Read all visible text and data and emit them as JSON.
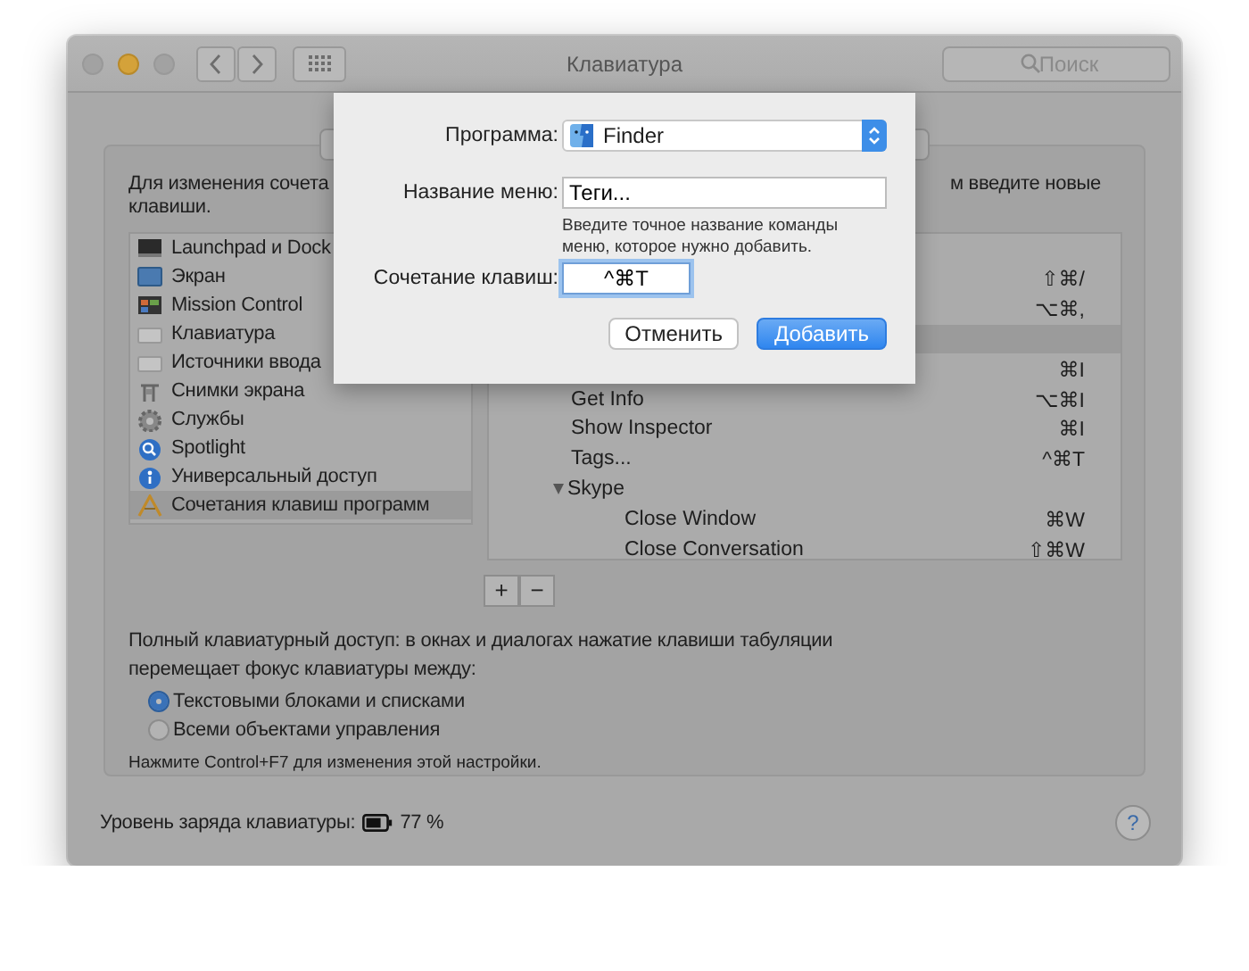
{
  "window": {
    "title": "Клавиатура",
    "search": {
      "placeholder": "Поиск"
    }
  },
  "description": {
    "left_part": "Для изменения сочета",
    "right_part": "м введите новые",
    "second_line": "клавиши."
  },
  "categories": [
    {
      "label": "Launchpad и Dock",
      "selected": false
    },
    {
      "label": "Экран",
      "selected": false
    },
    {
      "label": "Mission Control",
      "selected": false
    },
    {
      "label": "Клавиатура",
      "selected": false
    },
    {
      "label": "Источники ввода",
      "selected": false
    },
    {
      "label": "Снимки экрана",
      "selected": false
    },
    {
      "label": "Службы",
      "selected": false
    },
    {
      "label": "Spotlight",
      "selected": false
    },
    {
      "label": "Универсальный доступ",
      "selected": false
    },
    {
      "label": "Сочетания клавиш программ",
      "selected": true
    }
  ],
  "shortcuts": [
    {
      "kind": "command",
      "shortcut": "⇧⌘/",
      "selected": false
    },
    {
      "kind": "command",
      "shortcut": "⌥⌘,",
      "selected": false
    },
    {
      "kind": "command",
      "selected": true
    },
    {
      "kind": "command",
      "shortcut": "⌘I",
      "selected": false
    },
    {
      "kind": "command",
      "name": "Get Info",
      "shortcut": "⌥⌘I",
      "selected": false
    },
    {
      "kind": "command",
      "name": "Show Inspector",
      "shortcut": "⌘I",
      "selected": false
    },
    {
      "kind": "command",
      "name": "Tags...",
      "shortcut": "^⌘T",
      "selected": false
    },
    {
      "kind": "app",
      "name": "Skype",
      "expanded": true,
      "selected": false,
      "children": [
        {
          "kind": "command",
          "name": "Close Window",
          "shortcut": "⌘W",
          "selected": false
        },
        {
          "kind": "command",
          "name": "Close Conversation",
          "shortcut": "⇧⌘W",
          "selected": false
        }
      ]
    }
  ],
  "list_buttons": [
    "+",
    "−"
  ],
  "full_access": {
    "text": "Полный клавиатурный доступ: в окнах и диалогах нажатие клавиши табуляции перемещает фокус клавиатуры между:",
    "options": [
      {
        "label": "Текстовыми блоками и списками",
        "selected": true
      },
      {
        "label": "Всеми объектами управления",
        "selected": false
      }
    ],
    "note": "Нажмите Control+F7 для изменения этой настройки."
  },
  "battery": {
    "label": "Уровень заряда клавиатуры:",
    "reading": "77 %"
  },
  "help": "?",
  "sheet": {
    "program_label": "Программа:",
    "program": "Finder",
    "menu_label": "Название меню:",
    "menu_value": "Теги...",
    "hint": "Введите точное название команды меню, которое нужно добавить.",
    "shortcut_label": "Сочетание клавиш:",
    "shortcut_value": "^⌘T",
    "buttons": [
      {
        "label": "Отменить",
        "default": false
      },
      {
        "label": "Добавить",
        "default": true
      }
    ]
  }
}
